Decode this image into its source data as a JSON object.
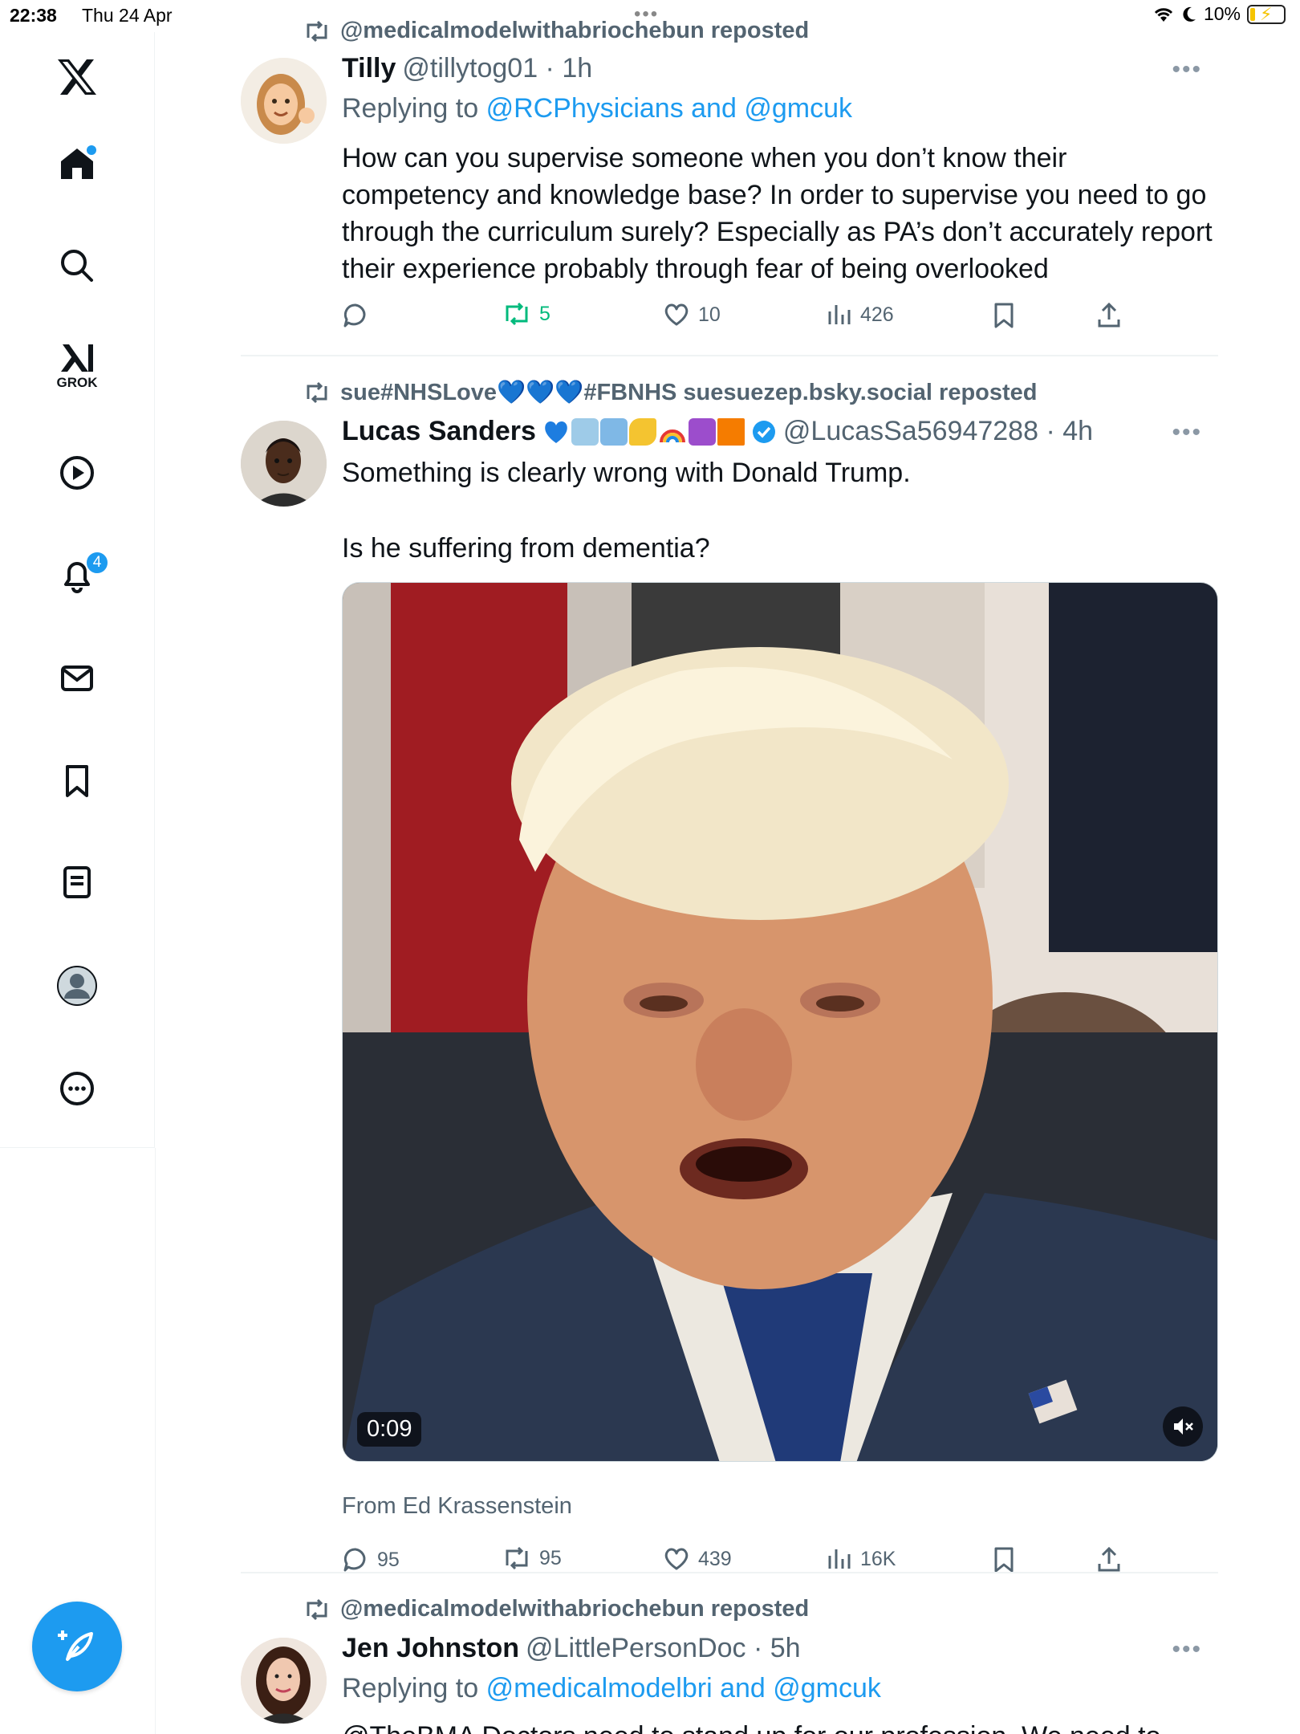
{
  "status": {
    "time": "22:38",
    "date": "Thu 24 Apr",
    "battery": "10%"
  },
  "sidebar": {
    "items": [
      "home",
      "explore",
      "grok",
      "video",
      "notifications",
      "messages",
      "bookmarks",
      "lists",
      "profile",
      "more"
    ],
    "grok_label": "GROK",
    "notification_count": "4"
  },
  "posts": [
    {
      "repost_by": "@medicalmodelwithabriochebun reposted",
      "name": "Tilly",
      "handle_time": "@tillytog01 · 1h",
      "replying_prefix": "Replying to",
      "replying_to": "@RCPhysicians and @gmcuk",
      "text": "How can you supervise someone when you don’t know their competency and knowledge base? In order to supervise you need to go through the curriculum surely? Especially as PA’s don’t accurately report their experience probably through fear of being overlooked",
      "replies": "",
      "reposts": "5",
      "likes": "10",
      "views": "426"
    },
    {
      "repost_by": "sue#NHSLove💙💙💙#FBNHS suesuezep.bsky.social reposted",
      "name": "Lucas Sanders",
      "handle_time": "@LucasSa56947288 · 4h",
      "text_line1": "Something is clearly wrong with Donald Trump.",
      "text_line2": "Is he suffering from dementia?",
      "video_time": "0:09",
      "from": "From Ed Krassenstein",
      "replies": "95",
      "reposts": "95",
      "likes": "439",
      "views": "16K"
    },
    {
      "repost_by": "@medicalmodelwithabriochebun reposted",
      "name": "Jen Johnston",
      "handle_time": "@LittlePersonDoc · 5h",
      "replying_prefix": "Replying to",
      "replying_to": "@medicalmodelbri and @gmcuk",
      "text_partial": "@TheBMA Doctors need to stand up for our profession. We need to"
    }
  ],
  "colors": {
    "accent": "#1d9bf0",
    "repost_green": "#00ba7c",
    "muted": "#536471"
  }
}
